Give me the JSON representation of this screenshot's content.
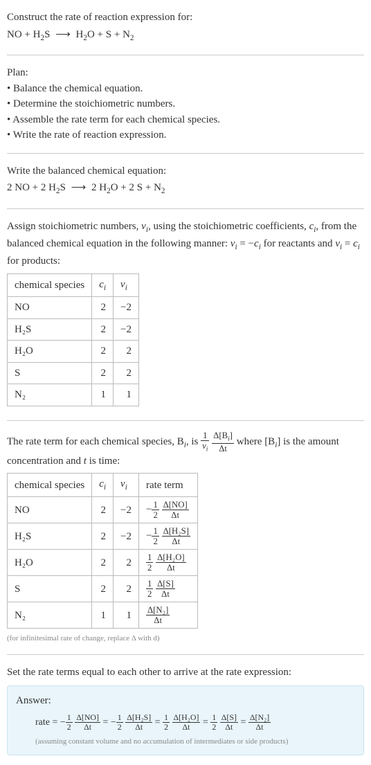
{
  "intro": {
    "prompt": "Construct the rate of reaction expression for:",
    "eq_lhs1": "NO",
    "eq_plus": " + ",
    "eq_lhs2": "H",
    "eq_lhs2_sub": "2",
    "eq_lhs2b": "S",
    "arrow": "⟶",
    "eq_rhs1": "H",
    "eq_rhs1_sub": "2",
    "eq_rhs1b": "O",
    "eq_rhs2": "S",
    "eq_rhs3": "N",
    "eq_rhs3_sub": "2"
  },
  "plan": {
    "heading": "Plan:",
    "items": [
      "• Balance the chemical equation.",
      "• Determine the stoichiometric numbers.",
      "• Assemble the rate term for each chemical species.",
      "• Write the rate of reaction expression."
    ]
  },
  "balanced": {
    "heading": "Write the balanced chemical equation:",
    "c1": "2 NO",
    "c2": "2 H",
    "c2_sub": "2",
    "c2b": "S",
    "arrow": "⟶",
    "p1": "2 H",
    "p1_sub": "2",
    "p1b": "O",
    "p2": "2 S",
    "p3": "N",
    "p3_sub": "2"
  },
  "assign": {
    "text1": "Assign stoichiometric numbers, ",
    "nu_i": "ν",
    "nu_sub": "i",
    "text2": ", using the stoichiometric coefficients, ",
    "c_i": "c",
    "c_sub": "i",
    "text3": ", from the balanced chemical equation in the following manner: ",
    "rel_react": "ν",
    "rel_react_sub": "i",
    "rel_react_eq": " = −",
    "rel_react_c": "c",
    "rel_react_csub": "i",
    "text4": " for reactants and ",
    "rel_prod": "ν",
    "rel_prod_sub": "i",
    "rel_prod_eq": " = ",
    "rel_prod_c": "c",
    "rel_prod_csub": "i",
    "text5": " for products:"
  },
  "table1": {
    "h1": "chemical species",
    "h2": "c",
    "h2_sub": "i",
    "h3": "ν",
    "h3_sub": "i",
    "rows": [
      {
        "sp": "NO",
        "c": "2",
        "nu": "−2"
      },
      {
        "sp": "H₂S",
        "c": "2",
        "nu": "−2"
      },
      {
        "sp": "H₂O",
        "c": "2",
        "nu": "2"
      },
      {
        "sp": "S",
        "c": "2",
        "nu": "2"
      },
      {
        "sp": "N₂",
        "c": "1",
        "nu": "1"
      }
    ]
  },
  "rateterm": {
    "t1": "The rate term for each chemical species, B",
    "t1_sub": "i",
    "t2": ", is ",
    "f1n": "1",
    "f1d": "ν",
    "f1d_sub": "i",
    "f2n": "Δ[B",
    "f2n_sub": "i",
    "f2n2": "]",
    "f2d": "Δt",
    "t3": " where [B",
    "t3_sub": "i",
    "t4": "] is the amount concentration and ",
    "t_var": "t",
    "t5": " is time:"
  },
  "table2": {
    "h1": "chemical species",
    "h2": "c",
    "h2_sub": "i",
    "h3": "ν",
    "h3_sub": "i",
    "h4": "rate term",
    "rows": [
      {
        "sp": "NO",
        "c": "2",
        "nu": "−2",
        "sign": "−",
        "coef_n": "1",
        "coef_d": "2",
        "conc": "Δ[NO]",
        "dt": "Δt"
      },
      {
        "sp": "H₂S",
        "c": "2",
        "nu": "−2",
        "sign": "−",
        "coef_n": "1",
        "coef_d": "2",
        "conc": "Δ[H₂S]",
        "dt": "Δt"
      },
      {
        "sp": "H₂O",
        "c": "2",
        "nu": "2",
        "sign": "",
        "coef_n": "1",
        "coef_d": "2",
        "conc": "Δ[H₂O]",
        "dt": "Δt"
      },
      {
        "sp": "S",
        "c": "2",
        "nu": "2",
        "sign": "",
        "coef_n": "1",
        "coef_d": "2",
        "conc": "Δ[S]",
        "dt": "Δt"
      },
      {
        "sp": "N₂",
        "c": "1",
        "nu": "1",
        "sign": "",
        "coef_n": "",
        "coef_d": "",
        "conc": "Δ[N₂]",
        "dt": "Δt"
      }
    ],
    "note": "(for infinitesimal rate of change, replace Δ with d)"
  },
  "final": {
    "heading": "Set the rate terms equal to each other to arrive at the rate expression:"
  },
  "answer": {
    "label": "Answer:",
    "lead": "rate = ",
    "t1_sign": "−",
    "t1_cn": "1",
    "t1_cd": "2",
    "t1_num": "Δ[NO]",
    "t1_den": "Δt",
    "eq": " = ",
    "t2_sign": "−",
    "t2_cn": "1",
    "t2_cd": "2",
    "t2_num": "Δ[H₂S]",
    "t2_den": "Δt",
    "t3_cn": "1",
    "t3_cd": "2",
    "t3_num": "Δ[H₂O]",
    "t3_den": "Δt",
    "t4_cn": "1",
    "t4_cd": "2",
    "t4_num": "Δ[S]",
    "t4_den": "Δt",
    "t5_num": "Δ[N₂]",
    "t5_den": "Δt",
    "assume": "(assuming constant volume and no accumulation of intermediates or side products)"
  },
  "chart_data": {
    "type": "table",
    "title": "Stoichiometric numbers and rate terms",
    "tables": [
      {
        "columns": [
          "chemical species",
          "c_i",
          "ν_i"
        ],
        "rows": [
          [
            "NO",
            2,
            -2
          ],
          [
            "H2S",
            2,
            -2
          ],
          [
            "H2O",
            2,
            2
          ],
          [
            "S",
            2,
            2
          ],
          [
            "N2",
            1,
            1
          ]
        ]
      },
      {
        "columns": [
          "chemical species",
          "c_i",
          "ν_i",
          "rate term"
        ],
        "rows": [
          [
            "NO",
            2,
            -2,
            "-(1/2) Δ[NO]/Δt"
          ],
          [
            "H2S",
            2,
            -2,
            "-(1/2) Δ[H2S]/Δt"
          ],
          [
            "H2O",
            2,
            2,
            "(1/2) Δ[H2O]/Δt"
          ],
          [
            "S",
            2,
            2,
            "(1/2) Δ[S]/Δt"
          ],
          [
            "N2",
            1,
            1,
            "Δ[N2]/Δt"
          ]
        ]
      }
    ]
  }
}
